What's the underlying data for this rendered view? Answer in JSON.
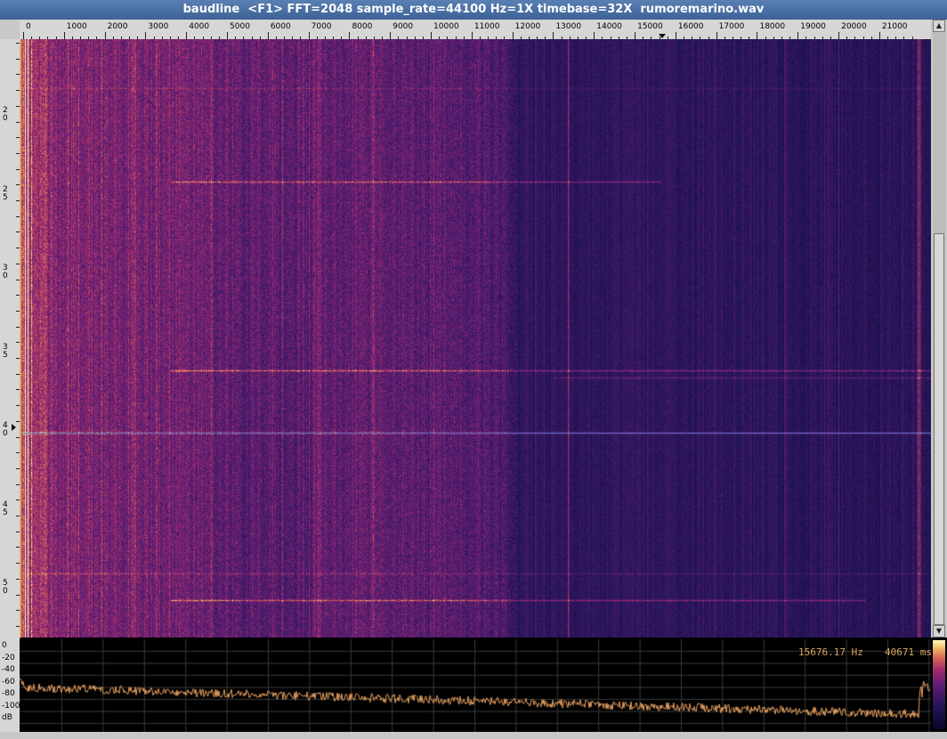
{
  "window": {
    "title": "baudline  <F1> FFT=2048 sample_rate=44100 Hz=1X timebase=32X  rumoremarino.wav"
  },
  "freq_axis": {
    "labels": [
      "0",
      "1000",
      "2000",
      "3000",
      "4000",
      "5000",
      "6000",
      "7000",
      "8000",
      "9000",
      "10000",
      "11000",
      "12000",
      "13000",
      "14000",
      "15000",
      "16000",
      "17000",
      "18000",
      "19000",
      "20000",
      "21000"
    ],
    "max_hz": 22050,
    "marker_hz": 15676
  },
  "time_axis": {
    "labels": [
      "20",
      "25",
      "30",
      "35",
      "40",
      "45",
      "50"
    ],
    "marker_label": "40"
  },
  "spectrum": {
    "db_labels": [
      "0",
      "-20",
      "-40",
      "-60",
      "-80",
      "-100",
      "dB"
    ],
    "db_range": [
      0,
      -110
    ]
  },
  "readout": {
    "frequency": "15676.17 Hz",
    "time": "40671 ms"
  },
  "colors": {
    "title_bar": "#4a6fa5",
    "spectrum_line": "#e8a060",
    "cursor_line": "#4060c0",
    "readout": "#d8a860"
  },
  "icons": {
    "scroll_up": "triangle-up",
    "scroll_down": "triangle-down"
  }
}
